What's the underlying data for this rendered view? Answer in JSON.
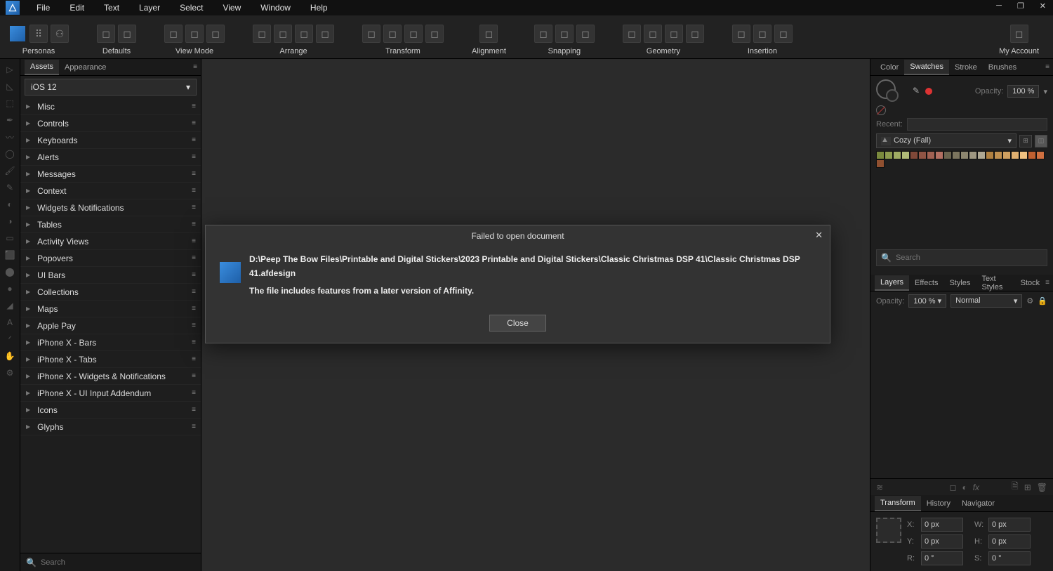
{
  "menu": [
    "File",
    "Edit",
    "Text",
    "Layer",
    "Select",
    "View",
    "Window",
    "Help"
  ],
  "toolbarGroups": [
    {
      "label": "Personas",
      "icons": 3,
      "first": true
    },
    {
      "label": "Defaults",
      "icons": 2
    },
    {
      "label": "View Mode",
      "icons": 3
    },
    {
      "label": "Arrange",
      "icons": 4
    },
    {
      "label": "Transform",
      "icons": 4
    },
    {
      "label": "Alignment",
      "icons": 1
    },
    {
      "label": "Snapping",
      "icons": 3
    },
    {
      "label": "Geometry",
      "icons": 4
    },
    {
      "label": "Insertion",
      "icons": 3
    },
    {
      "label": "My Account",
      "icons": 1,
      "right": true
    }
  ],
  "leftTabs": [
    "Assets",
    "Appearance"
  ],
  "leftActiveTab": 0,
  "assetDropdown": "iOS 12",
  "assetCategories": [
    "Misc",
    "Controls",
    "Keyboards",
    "Alerts",
    "Messages",
    "Context",
    "Widgets & Notifications",
    "Tables",
    "Activity Views",
    "Popovers",
    "UI Bars",
    "Collections",
    "Maps",
    "Apple Pay",
    "iPhone X - Bars",
    "iPhone X - Tabs",
    "iPhone X - Widgets & Notifications",
    "iPhone X - UI Input Addendum",
    "Icons",
    "Glyphs"
  ],
  "searchPlaceholder": "Search",
  "rightTabs1": [
    "Color",
    "Swatches",
    "Stroke",
    "Brushes"
  ],
  "rightActiveTab1": 1,
  "opacityLabel": "Opacity:",
  "opacityValue": "100 %",
  "recentLabel": "Recent:",
  "paletteName": "Cozy (Fall)",
  "swatchColors": [
    "#7a8a3d",
    "#8d9b4e",
    "#9fab62",
    "#b0ba78",
    "#804838",
    "#905444",
    "#a16152",
    "#b37062",
    "#6b644f",
    "#7c755e",
    "#8d866f",
    "#9e9781",
    "#afa893",
    "#b08040",
    "#c09050",
    "#d0a060",
    "#e0b070",
    "#f0c080",
    "#c06030",
    "#d07040",
    "#905030"
  ],
  "search2Placeholder": "Search",
  "rightTabs2": [
    "Layers",
    "Effects",
    "Styles",
    "Text Styles",
    "Stock"
  ],
  "rightActiveTab2": 0,
  "layerOpacityLabel": "Opacity:",
  "layerOpacity": "100 %",
  "blendMode": "Normal",
  "rightTabs3": [
    "Transform",
    "History",
    "Navigator"
  ],
  "rightActiveTab3": 0,
  "transform": {
    "xLabel": "X:",
    "x": "0 px",
    "yLabel": "Y:",
    "y": "0 px",
    "wLabel": "W:",
    "w": "0 px",
    "hLabel": "H:",
    "h": "0 px",
    "rLabel": "R:",
    "r": "0 °",
    "sLabel": "S:",
    "s": "0 °"
  },
  "modal": {
    "title": "Failed to open document",
    "path": "D:\\Peep The Bow Files\\Printable and Digital Stickers\\2023 Printable and Digital Stickers\\Classic Christmas DSP 41\\Classic Christmas DSP 41.afdesign",
    "message": "The file includes features from a later version of Affinity.",
    "button": "Close"
  }
}
